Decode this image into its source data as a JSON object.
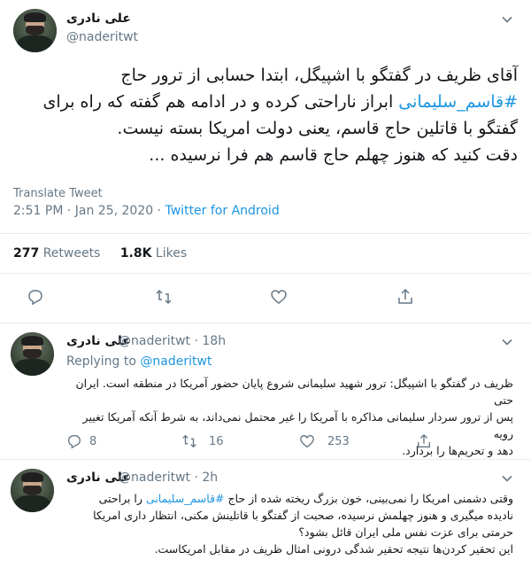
{
  "main_tweet": {
    "author_name": "علی نادری",
    "author_handle": "@naderitwt",
    "lines": [
      "آقای ظریف در گفتگو با اشپیگل، ابتدا حسابی از ترور حاج",
      "ابراز ناراحتی کرده و در ادامه هم گفته که راه برای",
      "گفتگو با قاتلین حاج قاسم، یعنی دولت امریکا بسته نیست.",
      "دقت کنید که هنوز چهلم حاج قاسم هم فرا نرسیده ..."
    ],
    "hashtag": "#قاسم_سلیمانی",
    "translate": "Translate Tweet",
    "timestamp": "2:51 PM · Jan 25, 2020 ·",
    "source": "Twitter for Android",
    "retweets_count": "277",
    "retweets_label": "Retweets",
    "likes_count": "1.8K",
    "likes_label": "Likes"
  },
  "reply1": {
    "author_name": "علی نادری",
    "handle_time": "@naderitwt · 18h",
    "replying_label": "Replying to",
    "replying_handle": "@naderitwt",
    "lines": [
      "ظریف در گفتگو با اشپیگل: ترور شهید سلیمانی شروع پایان حضور آمریکا در منطقه است. ایران حتی",
      "پس از ترور سردار سلیمانی مذاکره با آمریکا را غیر محتمل نمی‌داند، به شرط آنکه آمریکا تغییر رویه",
      "دهد و تحریم‌ها را بردارد."
    ],
    "reply_count": "8",
    "retweet_count": "16",
    "like_count": "253"
  },
  "reply2": {
    "author_name": "علی نادری",
    "handle_time": "@naderitwt · 2h",
    "line1_start": "وقتی دشمنی امریکا را نمی‌بینی، خون بزرگ ریخته شده از حاج",
    "hashtag": "#قاسم_سلیمانی",
    "line1_end": "را براحتی",
    "lines": [
      "نادیده میگیری و هنوز چهلمش نرسیده، صحبت از گفتگو با قاتلینش مکنی، انتظار داری امریکا",
      "حرمتی برای عزت نفس ملی ایران قائل بشود؟",
      "این تحقیر کردن‌ها نتیجه تحقیر شدگی درونی  امثال ظریف در مقابل امریکاست."
    ]
  }
}
